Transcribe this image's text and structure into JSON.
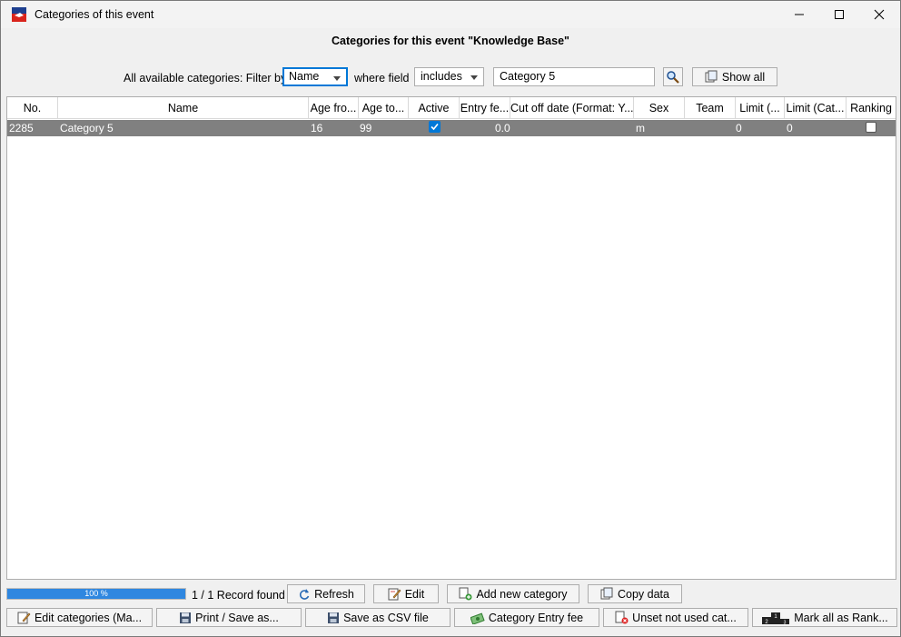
{
  "window": {
    "title": "Categories of this event",
    "heading": "Categories for this event \"Knowledge Base\""
  },
  "filter": {
    "label": "All available categories: Filter by",
    "field_value": "Name",
    "where_label": "where field",
    "operator_value": "includes",
    "search_value": "Category 5",
    "show_all_label": "Show all"
  },
  "table": {
    "columns": [
      "No.",
      "Name",
      "Age fro...",
      "Age to...",
      "Active",
      "Entry fe...",
      "Cut off date (Format: Y...",
      "Sex",
      "Team",
      "Limit (...",
      "Limit (Cat...",
      "Ranking"
    ],
    "rows": [
      {
        "no": "2285",
        "name": "Category 5",
        "age_from": "16",
        "age_to": "99",
        "active": true,
        "entry_fee": "0.0",
        "cut_off": "",
        "sex": "m",
        "team": "",
        "limit1": "0",
        "limit2": "0",
        "ranking": false
      }
    ]
  },
  "status": {
    "progress_percent": 100,
    "progress_label": "100 %",
    "record_text": "1 / 1 Record found"
  },
  "buttons": {
    "refresh": "Refresh",
    "edit": "Edit",
    "add_new": "Add new category",
    "copy_data": "Copy data",
    "edit_categories": "Edit categories (Ma...",
    "print_save": "Print / Save as...",
    "save_csv": "Save as CSV file",
    "entry_fee": "Category Entry fee",
    "unset": "Unset not used cat...",
    "mark_all": "Mark all as Rank..."
  },
  "colors": {
    "selected_row": "#808080",
    "accent": "#0078d7",
    "progress": "#2f87e0"
  }
}
